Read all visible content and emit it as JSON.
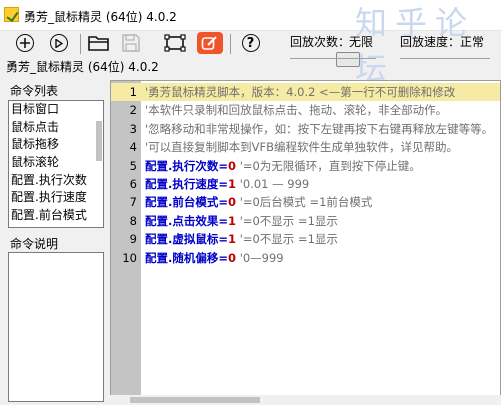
{
  "window": {
    "title": "勇芳_鼠标精灵 (64位) 4.0.2",
    "watermark": "知乎论坛"
  },
  "toolbar": {
    "buttons": [
      {
        "name": "add",
        "icon": "plus-circle-icon"
      },
      {
        "name": "play",
        "icon": "play-circle-icon"
      },
      {
        "name": "open",
        "icon": "folder-icon"
      },
      {
        "name": "save",
        "icon": "floppy-disk-icon"
      },
      {
        "name": "capture",
        "icon": "capture-frame-icon"
      },
      {
        "name": "edit",
        "icon": "pencil-edit-icon",
        "color": "#f0542a"
      },
      {
        "name": "help",
        "icon": "help-circle-icon",
        "symbol": "?"
      }
    ],
    "repeat_label": "回放次数：",
    "repeat_value": "无限",
    "speed_label": "回放速度：",
    "speed_value": "正常"
  },
  "status": {
    "text": "勇芳_鼠标精灵 (64位) 4.0.2"
  },
  "left_panel": {
    "commands_header": "命令列表",
    "commands": [
      "目标窗口",
      "鼠标点击",
      "鼠标拖移",
      "鼠标滚轮",
      "配置.执行次数",
      "配置.执行速度",
      "配置.前台模式"
    ],
    "description_header": "命令说明",
    "description_text": ""
  },
  "editor": {
    "lines": [
      {
        "no": "1",
        "comment": "'勇芳鼠标精灵脚本，版本：4.0.2 <—第一行不可删除和修改"
      },
      {
        "no": "2",
        "comment": "'本软件只录制和回放鼠标点击、拖动、滚轮，非全部动作。"
      },
      {
        "no": "3",
        "comment": "'忽略移动和非常规操作，如：按下左键再按下右键再释放左键等等。"
      },
      {
        "no": "4",
        "comment": "'可以直接复制脚本到VFB编程软件生成单独软件，详见帮助。"
      },
      {
        "no": "5",
        "kw": "配置.执行次数",
        "eq": "=",
        "val": "0",
        "comment": "'=0为无限循环，直到按下停止键。"
      },
      {
        "no": "6",
        "kw": "配置.执行速度",
        "eq": "=",
        "val": "1",
        "comment": "'0.01 — 999"
      },
      {
        "no": "7",
        "kw": "配置.前台模式",
        "eq": "=",
        "val": "0",
        "comment": "'=0后台模式 =1前台模式"
      },
      {
        "no": "8",
        "kw": "配置.点击效果",
        "eq": "=",
        "val": "1",
        "comment": "'=0不显示 =1显示"
      },
      {
        "no": "9",
        "kw": "配置.虚拟鼠标",
        "eq": "=",
        "val": "1",
        "comment": "'=0不显示 =1显示"
      },
      {
        "no": "10",
        "kw": "配置.随机偏移",
        "eq": "=",
        "val": "0",
        "comment": "'0—999"
      }
    ]
  }
}
